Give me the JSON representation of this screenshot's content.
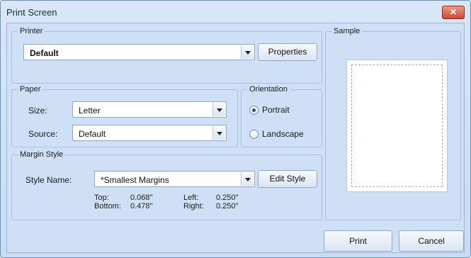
{
  "window": {
    "title": "Print Screen"
  },
  "printer": {
    "legend": "Printer",
    "selected": "Default",
    "properties_label": "Properties"
  },
  "paper": {
    "legend": "Paper",
    "size_label": "Size:",
    "size_value": "Letter",
    "source_label": "Source:",
    "source_value": "Default"
  },
  "orientation": {
    "legend": "Orientation",
    "portrait_label": "Portrait",
    "landscape_label": "Landscape",
    "selected": "Portrait"
  },
  "margin_style": {
    "legend": "Margin Style",
    "style_name_label": "Style Name:",
    "style_name_value": "*Smallest Margins",
    "edit_label": "Edit Style",
    "top_label": "Top:",
    "top_value": "0.068\"",
    "bottom_label": "Bottom:",
    "bottom_value": "0.478\"",
    "left_label": "Left:",
    "left_value": "0.250\"",
    "right_label": "Right:",
    "right_value": "0.250\""
  },
  "sample": {
    "legend": "Sample"
  },
  "actions": {
    "print_label": "Print",
    "cancel_label": "Cancel"
  },
  "icons": {
    "close": "close-icon",
    "dropdown": "chevron-down-icon"
  }
}
